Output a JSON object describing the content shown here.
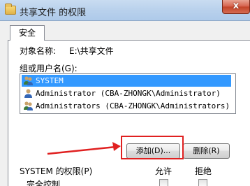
{
  "window": {
    "title": "共享文件 的权限",
    "close_glyph": "x"
  },
  "tabs": [
    {
      "label": "安全"
    }
  ],
  "object": {
    "label": "对象名称:",
    "value": "E:\\共享文件"
  },
  "users": {
    "label": "组或用户名(G):",
    "items": [
      {
        "name": "SYSTEM",
        "icon": "user-group-icon",
        "selected": true
      },
      {
        "name": "Administrator (CBA-ZHONGK\\Administrator)",
        "icon": "user-icon",
        "selected": false
      },
      {
        "name": "Administrators (CBA-ZHONGK\\Administrators)",
        "icon": "user-group-icon",
        "selected": false
      }
    ]
  },
  "buttons": {
    "add": "添加(D)...",
    "remove": "删除(R)"
  },
  "permissions": {
    "label": "SYSTEM 的权限(P)",
    "allow": "允许",
    "deny": "拒绝",
    "rows": [
      {
        "name": "完全控制"
      }
    ]
  },
  "colors": {
    "highlight": "#e02020",
    "selection": "#3399ff"
  }
}
